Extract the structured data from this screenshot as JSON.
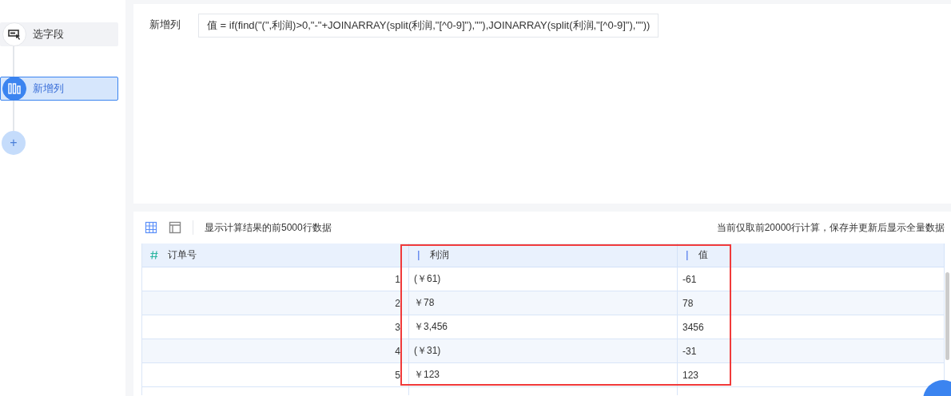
{
  "sidebar": {
    "steps": [
      {
        "kind": "field",
        "label": "选字段",
        "selected": false
      },
      {
        "kind": "column",
        "label": "新增列",
        "selected": true
      }
    ],
    "add_button": {
      "label": "+"
    }
  },
  "formula": {
    "label": "新增列",
    "value": "值 = if(find(\"(\",利润)>0,\"-\"+JOINARRAY(split(利润,\"[^0-9]\"),\"\"),JOINARRAY(split(利润,\"[^0-9]\"),\"\"))"
  },
  "preview": {
    "view_tabs": [
      {
        "kind": "grid",
        "selected": true
      },
      {
        "kind": "layout",
        "selected": false
      }
    ],
    "note": "显示计算结果的前5000行数据",
    "limit_note": "当前仅取前20000行计算，保存并更新后显示全量数据"
  },
  "table": {
    "columns": [
      {
        "kind": "number",
        "label": "订单号"
      },
      {
        "kind": "text",
        "label": "利润"
      },
      {
        "kind": "text",
        "label": "值"
      }
    ],
    "rows": [
      [
        "1",
        "(￥61)",
        "-61"
      ],
      [
        "2",
        "￥78",
        "78"
      ],
      [
        "3",
        "￥3,456",
        "3456"
      ],
      [
        "4",
        "(￥31)",
        "-31"
      ],
      [
        "5",
        "￥123",
        "123"
      ]
    ]
  }
}
